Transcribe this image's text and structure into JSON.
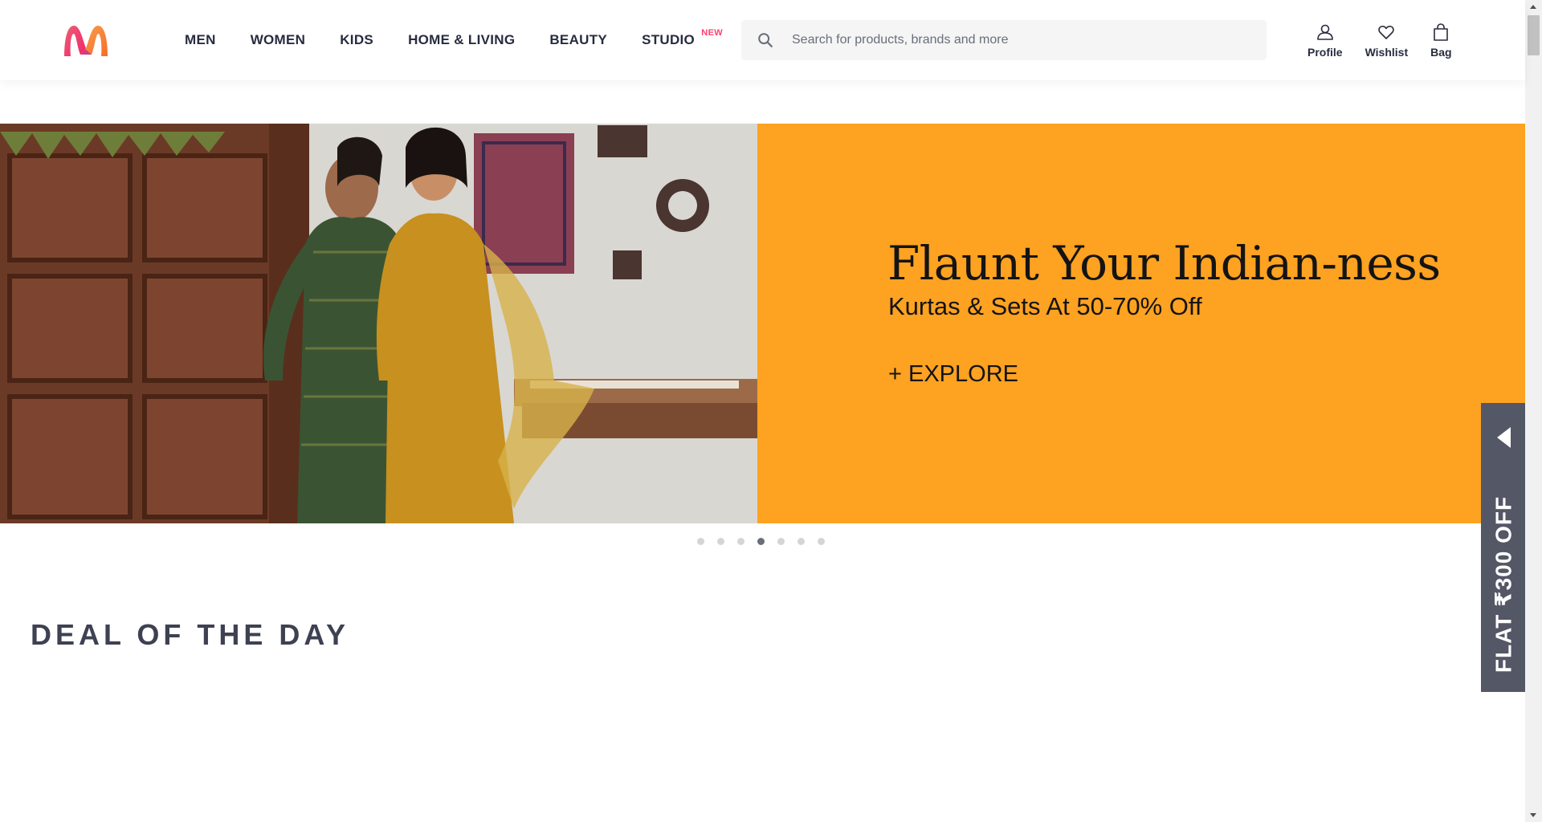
{
  "header": {
    "nav": [
      {
        "label": "MEN"
      },
      {
        "label": "WOMEN"
      },
      {
        "label": "KIDS"
      },
      {
        "label": "HOME & LIVING"
      },
      {
        "label": "BEAUTY"
      },
      {
        "label": "STUDIO",
        "badge": "NEW"
      }
    ],
    "search": {
      "placeholder": "Search for products, brands and more",
      "value": "",
      "icon": "search-icon"
    },
    "actions": [
      {
        "label": "Profile",
        "icon": "profile-icon"
      },
      {
        "label": "Wishlist",
        "icon": "heart-icon"
      },
      {
        "label": "Bag",
        "icon": "bag-icon"
      }
    ]
  },
  "banner": {
    "title": "Flaunt Your Indian-ness",
    "subtitle": "Kurtas & Sets At 50-70% Off",
    "cta": "+ EXPLORE",
    "panel_color": "#fda221",
    "slides_count": 7,
    "active_slide": 4
  },
  "deal_section": {
    "title": "DEAL OF THE DAY"
  },
  "coupon": {
    "text": "FLAT ₹300 OFF"
  },
  "colors": {
    "brand_pink": "#ff3f6c",
    "text_dark": "#282c3f",
    "coupon_bg": "#535766"
  }
}
